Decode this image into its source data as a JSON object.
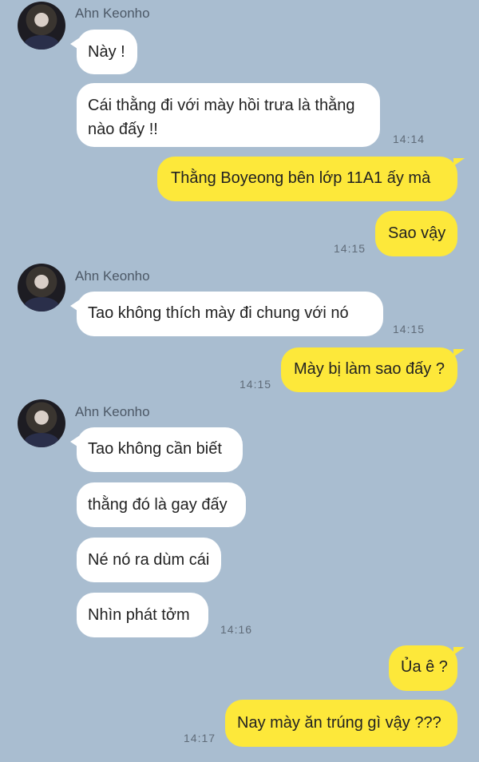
{
  "contact": {
    "name": "Ahn Keonho"
  },
  "messages": [
    {
      "text": "Này !"
    },
    {
      "text": "Cái thằng đi với mày hồi trưa là thằng nào đấy !!",
      "line1": "Cái thằng đi với mày hồi trưa là thằng",
      "line2": "nào đấy !!",
      "time": "14:14"
    },
    {
      "text": "Thằng Boyeong bên lớp 11A1 ấy mà"
    },
    {
      "text": "Sao vậy",
      "time": "14:15"
    },
    {
      "text": "Tao không thích mày đi chung với nó",
      "time": "14:15"
    },
    {
      "text": "Mày bị làm sao đấy ?",
      "time": "14:15"
    },
    {
      "text": "Tao không cần biết"
    },
    {
      "text": "thằng đó là gay đấy"
    },
    {
      "text": "Né nó ra dùm cái"
    },
    {
      "text": "Nhìn phát tởm",
      "time": "14:16"
    },
    {
      "text": "Ủa ê ?"
    },
    {
      "text": "Nay mày ăn trúng gì vậy ???",
      "time": "14:17"
    }
  ]
}
